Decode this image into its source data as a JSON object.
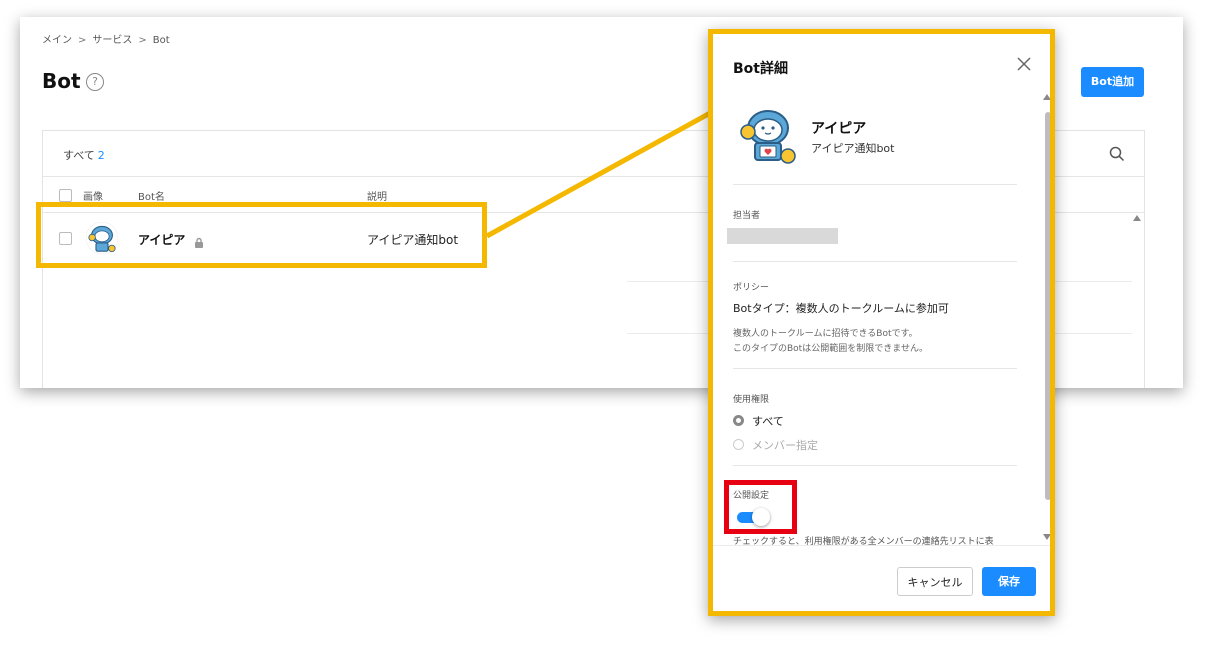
{
  "breadcrumb": [
    "メイン",
    "サービス",
    "Bot"
  ],
  "page": {
    "title": "Bot",
    "help_glyph": "?",
    "add_button": "Bot追加"
  },
  "list": {
    "all_label": "すべて",
    "all_count": "2",
    "columns": {
      "image": "画像",
      "name": "Bot名",
      "description": "説明"
    },
    "rows": [
      {
        "name": "アイピア",
        "description": "アイピア通知bot"
      }
    ]
  },
  "detail": {
    "title": "Bot詳細",
    "bot_name": "アイピア",
    "bot_subtitle": "アイピア通知bot",
    "owner_label": "担当者",
    "policy_label": "ポリシー",
    "policy_main": "Botタイプ：複数人のトークルームに参加可",
    "policy_note_1": "複数人のトークルームに招待できるBotです。",
    "policy_note_2": "このタイプのBotは公開範囲を制限できません。",
    "permission_label": "使用権限",
    "permission_options": [
      {
        "label": "すべて",
        "selected": true
      },
      {
        "label": "メンバー指定",
        "selected": false
      }
    ],
    "public_label": "公開設定",
    "public_on": true,
    "public_note": "チェックすると、利用権限がある全メンバーの連絡先リストに表",
    "cancel_button": "キャンセル",
    "save_button": "保存"
  },
  "colors": {
    "accent": "#1a8cff",
    "highlight_yellow": "#f5b800",
    "highlight_red": "#e60012"
  }
}
